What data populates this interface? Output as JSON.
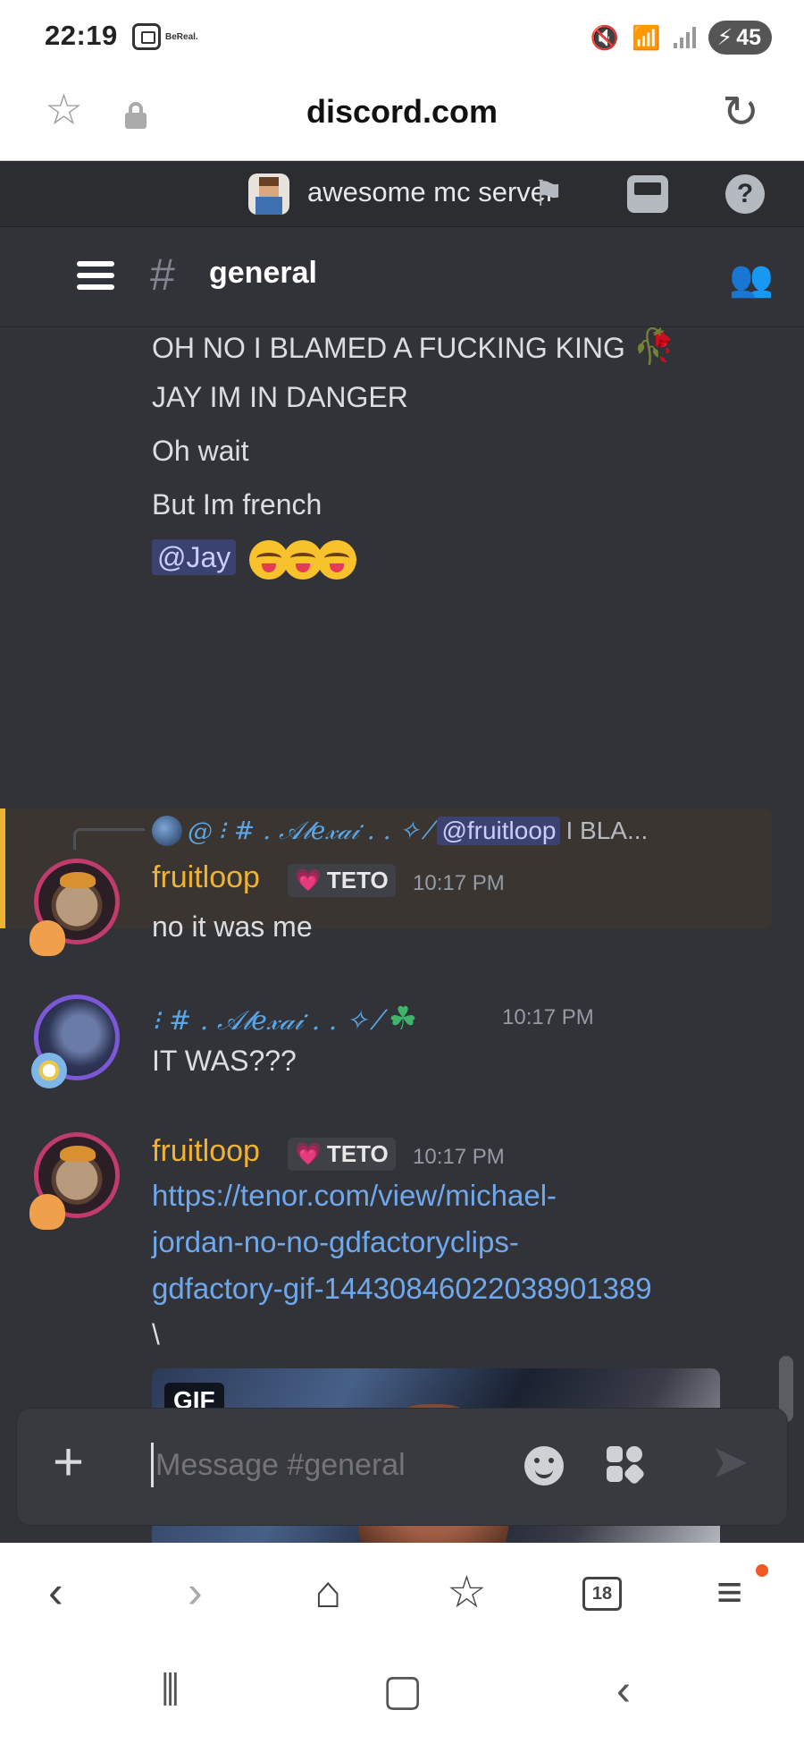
{
  "status_bar": {
    "time": "22:19",
    "app_label": "BeReal.",
    "battery": "45"
  },
  "browser": {
    "url": "discord.com"
  },
  "server": {
    "name": "awesome mc server"
  },
  "channel": {
    "name": "general",
    "hash": "#"
  },
  "messages": {
    "l1": "OH NO I BLAMED A FUCKING KING",
    "l2": "JAY IM IN DANGER",
    "l3": "Oh wait",
    "l4": "But Im french",
    "l5_mention": "@Jay"
  },
  "reply": {
    "prefix": "@",
    "name": "⁝ # . 𝒜𝓁𝑒𝓍𝒶𝒾 . . ✧ ⁄",
    "mention": "@fruitloop",
    "excerpt": "I BLA..."
  },
  "msg1": {
    "author": "fruitloop",
    "tag": "TETO",
    "time": "10:17 PM",
    "text": "no it was me"
  },
  "msg2": {
    "author": "⁝ # . 𝒜𝓁𝑒𝓍𝒶𝒾 . . ✧ ⁄",
    "time": "10:17 PM",
    "text": "IT WAS???"
  },
  "msg3": {
    "author": "fruitloop",
    "tag": "TETO",
    "time": "10:17 PM",
    "link1": "https://tenor.com/view/michael-",
    "link2": "jordan-no-no-gdfactoryclips-",
    "link3": "gdfactory-gif-14430846022038901389",
    "trail": "\\",
    "gif_label": "GIF"
  },
  "composer": {
    "placeholder": "Message #general"
  },
  "bottom_nav": {
    "tabs_count": "18"
  },
  "colors": {
    "accent": "#f0b232",
    "link": "#6fa8ec",
    "bg": "#313338"
  }
}
